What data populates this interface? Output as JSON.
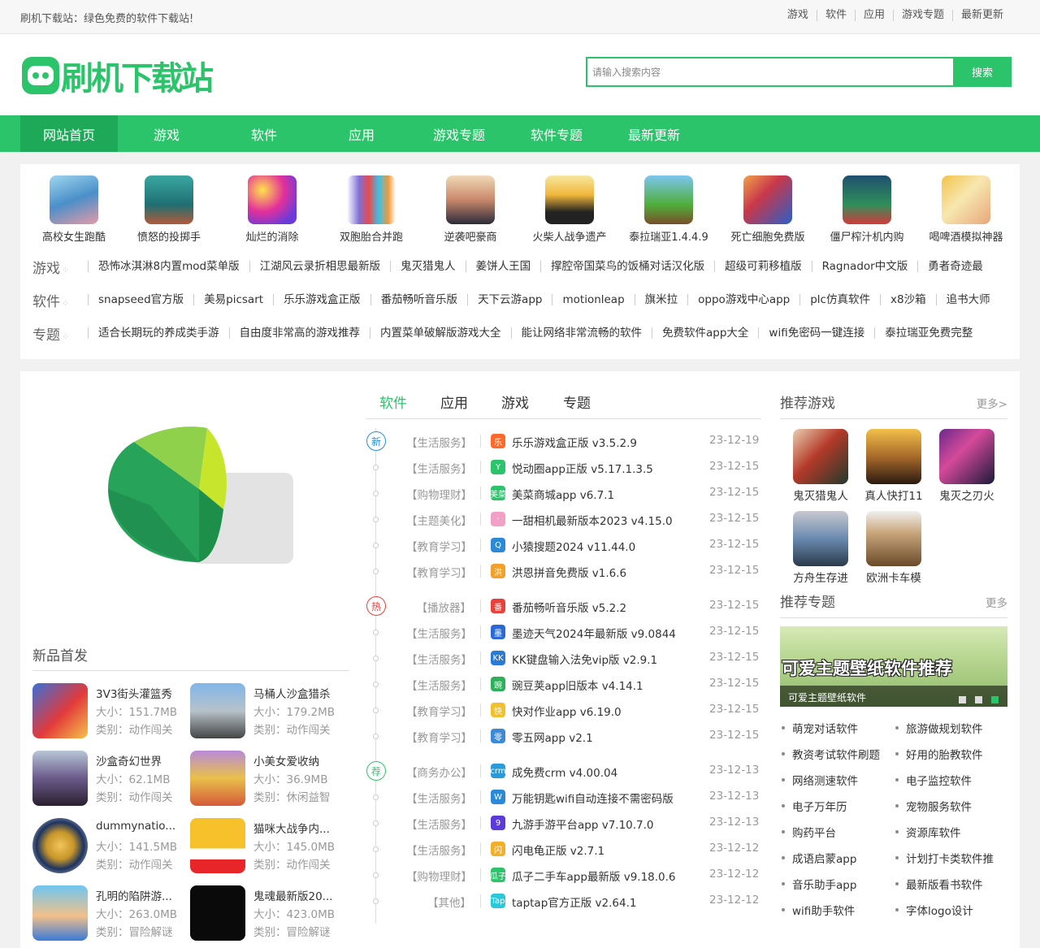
{
  "top": {
    "site_text": "刷机下载站：绿色免费的软件下载站!",
    "links": [
      "游戏",
      "软件",
      "应用",
      "游戏专题",
      "最新更新"
    ]
  },
  "header": {
    "logo_text": "刷机下载站",
    "search_placeholder": "请输入搜索内容",
    "search_button": "搜索"
  },
  "nav": [
    "网站首页",
    "游戏",
    "软件",
    "应用",
    "游戏专题",
    "软件专题",
    "最新更新"
  ],
  "featured_apps": [
    "高校女生跑酷",
    "愤怒的投掷手",
    "灿烂的消除",
    "双胞胎合并跑",
    "逆袭吧豪商",
    "火柴人战争遗产",
    "泰拉瑞亚1.4.4.9",
    "死亡细胞免费版",
    "僵尸榨汁机内购",
    "喝啤酒模拟神器"
  ],
  "tag_rows": [
    {
      "label": "游戏",
      "tags": [
        "恐怖冰淇淋8内置mod菜单版",
        "江湖风云录折相思最新版",
        "鬼灭猎鬼人",
        "姜饼人王国",
        "撑腔帝国菜鸟的饭桶对话汉化版",
        "超级可莉移植版",
        "Ragnador中文版",
        "勇者奇迹最"
      ]
    },
    {
      "label": "软件",
      "tags": [
        "snapseed官方版",
        "美易picsart",
        "乐乐游戏盒正版",
        "番茄畅听音乐版",
        "天下云游app",
        "motionleap",
        "旗米拉",
        "oppo游戏中心app",
        "plc仿真软件",
        "x8沙箱",
        "追书大师"
      ]
    },
    {
      "label": "专题",
      "tags": [
        "适合长期玩的养成类手游",
        "自由度非常高的游戏推荐",
        "内置菜单破解版游戏大全",
        "能让网络非常流畅的软件",
        "免费软件app大全",
        "wifi免密码一键连接",
        "泰拉瑞亚免费完整"
      ]
    }
  ],
  "new_release": {
    "title": "新品首发",
    "games": [
      {
        "name": "3V3街头灌篮秀",
        "size": "大小：151.7MB",
        "cat": "类别：动作闯关"
      },
      {
        "name": "马桶人沙盒猎杀",
        "size": "大小：179.2MB",
        "cat": "类别：动作闯关"
      },
      {
        "name": "沙盒奇幻世界",
        "size": "大小：62.1MB",
        "cat": "类别：动作闯关"
      },
      {
        "name": "小美女爱收纳",
        "size": "大小：36.9MB",
        "cat": "类别：休闲益智"
      },
      {
        "name": "dummynatio...",
        "size": "大小：141.5MB",
        "cat": "类别：动作闯关"
      },
      {
        "name": "猫咪大战争内...",
        "size": "大小：145.0MB",
        "cat": "类别：动作闯关"
      },
      {
        "name": "孔明的陷阱游...",
        "size": "大小：263.0MB",
        "cat": "类别：冒险解谜"
      },
      {
        "name": "鬼魂最新版20...",
        "size": "大小：423.0MB",
        "cat": "类别：冒险解谜"
      }
    ]
  },
  "mid_tabs": [
    "软件",
    "应用",
    "游戏",
    "专题"
  ],
  "markers": [
    "新",
    "热",
    "荐"
  ],
  "mid_list": [
    {
      "cat": "【生活服务】",
      "icon": "乐",
      "title": "乐乐游戏盒正版 v3.5.2.9",
      "date": "23-12-19"
    },
    {
      "cat": "【生活服务】",
      "icon": "Y",
      "title": "悦动圈app正版 v5.17.1.3.5",
      "date": "23-12-15"
    },
    {
      "cat": "【购物理财】",
      "icon": "美菜",
      "title": "美菜商城app v6.7.1",
      "date": "23-12-15"
    },
    {
      "cat": "【主题美化】",
      "icon": "·",
      "title": "一甜相机最新版本2023 v4.15.0",
      "date": "23-12-15"
    },
    {
      "cat": "【教育学习】",
      "icon": "Q",
      "title": "小猿搜题2024 v11.44.0",
      "date": "23-12-15"
    },
    {
      "cat": "【教育学习】",
      "icon": "洪",
      "title": "洪恩拼音免费版 v1.6.6",
      "date": "23-12-15"
    },
    {
      "cat": "【播放器】",
      "icon": "番",
      "title": "番茄畅听音乐版 v5.2.2",
      "date": "23-12-15"
    },
    {
      "cat": "【生活服务】",
      "icon": "墨",
      "title": "墨迹天气2024年最新版 v9.0844",
      "date": "23-12-15"
    },
    {
      "cat": "【生活服务】",
      "icon": "KK",
      "title": "KK键盘输入法免vip版 v2.9.1",
      "date": "23-12-15"
    },
    {
      "cat": "【生活服务】",
      "icon": "豌",
      "title": "豌豆荚app旧版本 v4.14.1",
      "date": "23-12-15"
    },
    {
      "cat": "【教育学习】",
      "icon": "快",
      "title": "快对作业app v6.19.0",
      "date": "23-12-15"
    },
    {
      "cat": "【教育学习】",
      "icon": "零",
      "title": "零五网app v2.1",
      "date": "23-12-15"
    },
    {
      "cat": "【商务办公】",
      "icon": "crm",
      "title": "成免费crm v4.00.04",
      "date": "23-12-13"
    },
    {
      "cat": "【生活服务】",
      "icon": "W",
      "title": "万能钥匙wifi自动连接不需密码版",
      "date": "23-12-13"
    },
    {
      "cat": "【生活服务】",
      "icon": "9",
      "title": "九游手游平台app v7.10.7.0",
      "date": "23-12-13"
    },
    {
      "cat": "【生活服务】",
      "icon": "闪",
      "title": "闪电龟正版 v2.7.1",
      "date": "23-12-12"
    },
    {
      "cat": "【购物理财】",
      "icon": "瓜子",
      "title": "瓜子二手车app最新版 v9.18.0.6",
      "date": "23-12-12"
    },
    {
      "cat": "【其他】",
      "icon": "Tap",
      "title": "taptap官方正版 v2.64.1",
      "date": "23-12-12"
    }
  ],
  "recommend_games": {
    "title": "推荐游戏",
    "more": "更多>",
    "items": [
      "鬼灭猎鬼人",
      "真人快打11",
      "鬼灭之刃火",
      "方舟生存进",
      "欧洲卡车模"
    ]
  },
  "recommend_topics": {
    "title": "推荐专题",
    "more": "更多",
    "banner_title": "可爱主题壁纸软件推荐",
    "banner_caption": "可爱主题壁纸软件",
    "items": [
      "萌宠对话软件",
      "旅游做规划软件",
      "教资考试软件刷题",
      "好用的胎教软件",
      "网络测速软件",
      "电子监控软件",
      "电子万年历",
      "宠物服务软件",
      "购药平台",
      "资源库软件",
      "成语启蒙app",
      "计划打卡类软件推",
      "音乐助手app",
      "最新版看书软件",
      "wifi助手软件",
      "字体logo设计"
    ]
  },
  "colors": {
    "brand": "#2cc46b",
    "brand_dark": "#1ea958",
    "marker_new": "#2c8cd6",
    "marker_hot": "#e8413c",
    "marker_rec": "#2cc46b"
  }
}
